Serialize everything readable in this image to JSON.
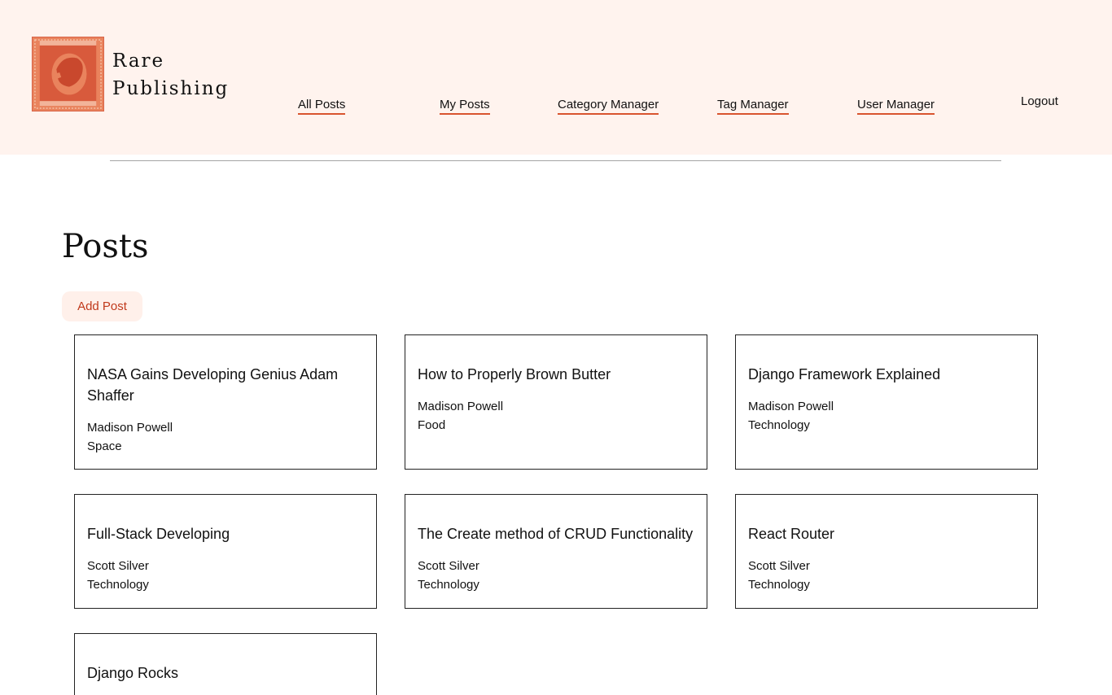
{
  "header": {
    "brand_line1": "Rare",
    "brand_line2": "Publishing",
    "nav": [
      {
        "label": "All Posts"
      },
      {
        "label": "My Posts"
      },
      {
        "label": "Category Manager"
      },
      {
        "label": "Tag Manager"
      },
      {
        "label": "User Manager"
      }
    ],
    "logout_label": "Logout",
    "logo_icon": "stamp-logo-icon",
    "accent_color": "#d9542f",
    "background_color": "#fff3ee"
  },
  "main": {
    "title": "Posts",
    "add_post_label": "Add Post",
    "posts": [
      {
        "title": "NASA Gains Developing Genius Adam Shaffer",
        "author": "Madison Powell",
        "category": "Space"
      },
      {
        "title": "How to Properly Brown Butter",
        "author": "Madison Powell",
        "category": "Food"
      },
      {
        "title": "Django Framework Explained",
        "author": "Madison Powell",
        "category": "Technology"
      },
      {
        "title": "Full-Stack Developing",
        "author": "Scott Silver",
        "category": "Technology"
      },
      {
        "title": "The Create method of CRUD Functionality",
        "author": "Scott Silver",
        "category": "Technology"
      },
      {
        "title": "React Router",
        "author": "Scott Silver",
        "category": "Technology"
      },
      {
        "title": "Django Rocks",
        "author": "",
        "category": ""
      }
    ]
  }
}
